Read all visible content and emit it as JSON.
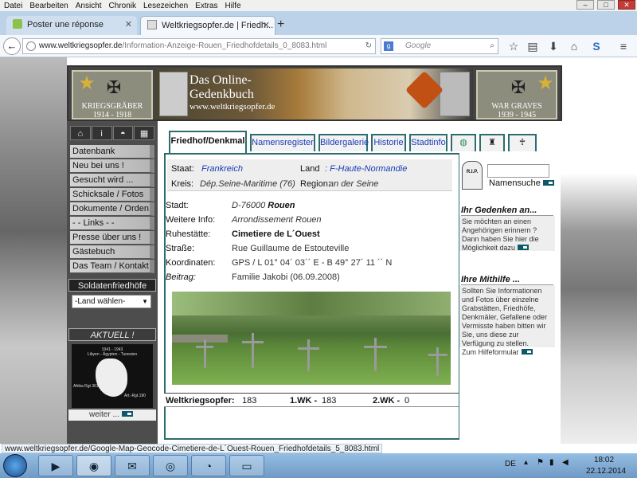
{
  "menubar": [
    "Datei",
    "Bearbeiten",
    "Ansicht",
    "Chronik",
    "Lesezeichen",
    "Extras",
    "Hilfe"
  ],
  "window_controls": {
    "minimize": "–",
    "maximize": "□",
    "close": "✕"
  },
  "tabs": [
    {
      "title": "Poster une réponse"
    },
    {
      "title": "Weltkriegsopfer.de | Friedh..."
    }
  ],
  "new_tab_label": "+",
  "address": {
    "domain": "www.weltkriegsopfer.de",
    "path": "/Information-Anzeige-Rouen_Friedhofdetails_0_8083.html"
  },
  "search": {
    "placeholder": "Google"
  },
  "banner": {
    "left_plate": "KRIEGSGRÄBER\n1914 - 1918",
    "title_line1": "Das Online-",
    "title_line2": "Gedenkbuch",
    "url": "www.weltkriegsopfer.de",
    "right_plate": "WAR GRAVES\n1939 - 1945"
  },
  "sidebar": {
    "menu": [
      "Datenbank",
      "Neu bei uns !",
      "Gesucht wird ...",
      "Schicksale / Fotos",
      "Dokumente / Orden",
      "- -  Links  - -",
      "Presse über uns !",
      "Gästebuch",
      "Das Team / Kontakt"
    ],
    "soldatenfriedhoefe": "Soldatenfriedhöfe",
    "land_select": "-Land wählen-",
    "aktuell": "AKTUELL !",
    "aktuell_img": {
      "line1": "1941 - 1943",
      "line2": "Libyen - Ägypten - Tunesien",
      "left": "Afrika Rgt 361",
      "right": "Art.-Rgt.190"
    },
    "weiter": "weiter ..."
  },
  "content_tabs": [
    "Friedhof/Denkmal",
    "Namensregister",
    "Bildergalerie",
    "Historie",
    "Stadtinfo"
  ],
  "details": {
    "staat_label": "Staat:",
    "staat": "Frankreich",
    "land_label": "Land",
    "land": ": F-Haute-Normandie",
    "kreis_label": "Kreis:",
    "kreis": "Dép.Seine-Maritime (76)",
    "region_label": "Region:",
    "region": "an der Seine",
    "stadt_label": "Stadt:",
    "stadt_plz": "D-76000 ",
    "stadt_name": "Rouen",
    "info_label": "Weitere Info:",
    "info": "Arrondissement Rouen",
    "ruhe_label": "Ruhestätte:",
    "ruhe": "Cimetiere de L´Ouest",
    "strasse_label": "Straße:",
    "strasse": "Rue Guillaume de Estouteville",
    "koord_label": "Koordinaten:",
    "koord": "GPS / L 01° 04´ 03´´ E - B 49° 27´ 11 ´´ N",
    "beitrag_label": "Beitrag:",
    "beitrag": "Familie Jakobi (06.09.2008)"
  },
  "stats": {
    "label": "Weltkriegsopfer:",
    "total": "183",
    "wk1_label": "1.WK -",
    "wk1": "183",
    "wk2_label": "2.WK -",
    "wk2": "0"
  },
  "right": {
    "rip": "R.I.P.",
    "namenssuche": "Namensuche",
    "gedenken_head": "Ihr Gedenken an...",
    "gedenken_text": "Sie möchten an einen Angehörigen erinnern ? Dann haben Sie hier die Möglichkeit dazu",
    "mithilfe_head": "Ihre Mithilfe ...",
    "mithilfe_text": "Sollten Sie Informationen und Fotos über einzelne Grabstätten, Friedhöfe, Denkmäler, Gefallene oder Vermisste haben bitten wir Sie, uns diese zur Verfügung zu stellen.",
    "mithilfe_link": "Zum Hilfeformular"
  },
  "statusbar": "www.weltkriegsopfer.de/Google-Map-Geocode-Cimetiere-de-L´Ouest-Rouen_Friedhofdetails_5_8083.html",
  "taskbar": {
    "lang": "DE",
    "time": "18:02",
    "date": "22.12.2014"
  }
}
